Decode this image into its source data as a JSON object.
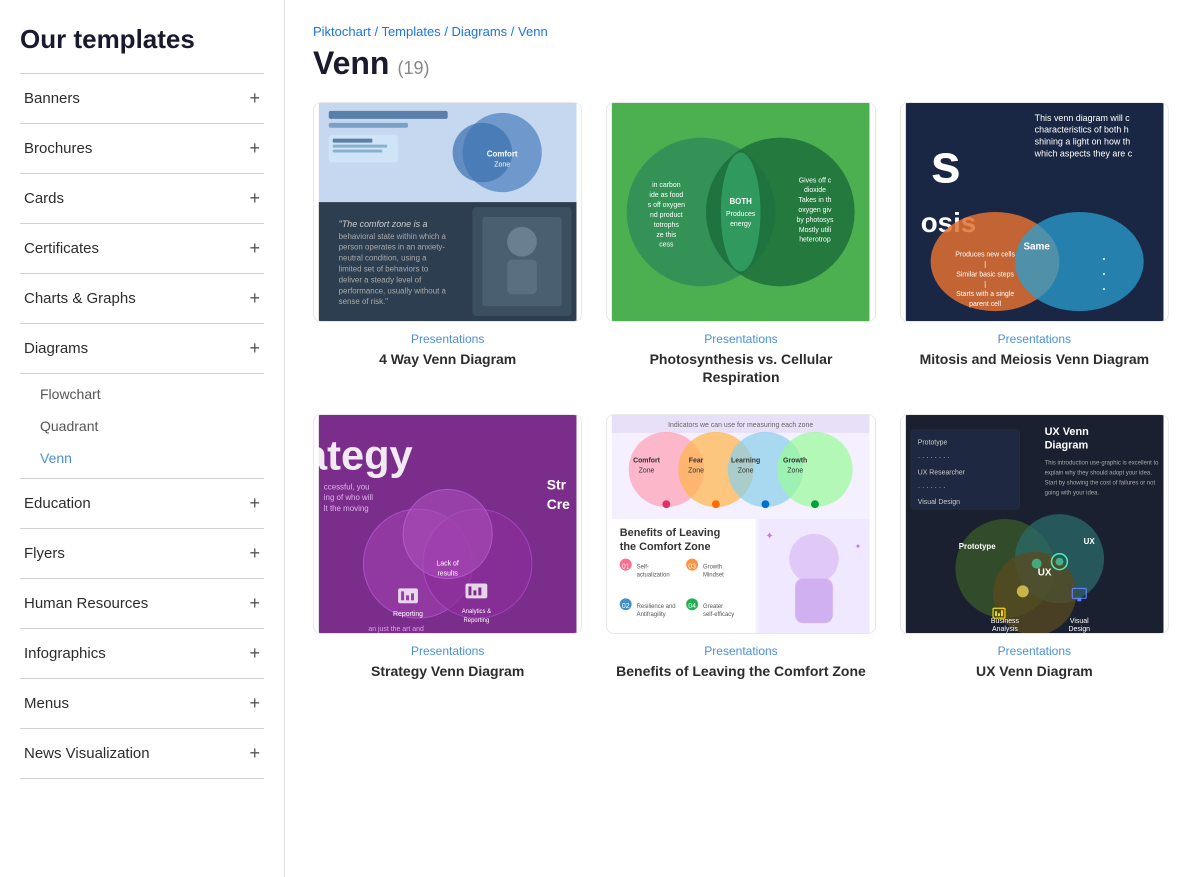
{
  "sidebar": {
    "heading": "Our templates",
    "items": [
      {
        "id": "banners",
        "label": "Banners",
        "expandable": true,
        "expanded": false
      },
      {
        "id": "brochures",
        "label": "Brochures",
        "expandable": true,
        "expanded": false
      },
      {
        "id": "cards",
        "label": "Cards",
        "expandable": true,
        "expanded": false
      },
      {
        "id": "certificates",
        "label": "Certificates",
        "expandable": true,
        "expanded": false
      },
      {
        "id": "charts-graphs",
        "label": "Charts & Graphs",
        "expandable": true,
        "expanded": false
      },
      {
        "id": "diagrams",
        "label": "Diagrams",
        "expandable": true,
        "expanded": true,
        "children": [
          "Flowchart",
          "Quadrant",
          "Venn"
        ]
      },
      {
        "id": "education",
        "label": "Education",
        "expandable": true,
        "expanded": false
      },
      {
        "id": "flyers",
        "label": "Flyers",
        "expandable": true,
        "expanded": false
      },
      {
        "id": "human-resources",
        "label": "Human Resources",
        "expandable": true,
        "expanded": false
      },
      {
        "id": "infographics",
        "label": "Infographics",
        "expandable": true,
        "expanded": false
      },
      {
        "id": "menus",
        "label": "Menus",
        "expandable": true,
        "expanded": false
      },
      {
        "id": "news-visualization",
        "label": "News Visualization",
        "expandable": true,
        "expanded": false
      }
    ]
  },
  "breadcrumb": {
    "items": [
      "Piktochart",
      "Templates",
      "Diagrams",
      "Venn"
    ],
    "separator": " / "
  },
  "page": {
    "title": "Venn",
    "count": "(19)"
  },
  "templates": [
    {
      "id": "t1",
      "category": "Presentations",
      "name": "4 Way Venn Diagram",
      "thumb_type": "venn1"
    },
    {
      "id": "t2",
      "category": "Presentations",
      "name": "Photosynthesis vs. Cellular Respiration",
      "thumb_type": "venn2"
    },
    {
      "id": "t3",
      "category": "Presentations",
      "name": "Mitosis and Meiosis Venn Diagram",
      "thumb_type": "venn3"
    },
    {
      "id": "t4",
      "category": "Presentations",
      "name": "Strategy Venn Diagram",
      "thumb_type": "venn4"
    },
    {
      "id": "t5",
      "category": "Presentations",
      "name": "Benefits of Leaving the Comfort Zone",
      "thumb_type": "venn5"
    },
    {
      "id": "t6",
      "category": "Presentations",
      "name": "UX Venn Diagram",
      "thumb_type": "venn6"
    }
  ],
  "colors": {
    "accent": "#4a90d9",
    "active_nav": "#4a90d9"
  }
}
